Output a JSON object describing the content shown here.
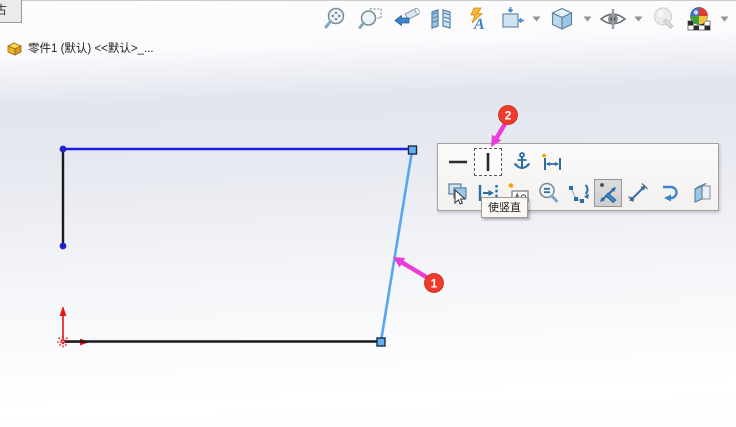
{
  "tabs": {
    "partial_tab_text": "古"
  },
  "feature_tree": {
    "part_label": "零件1 (默认) <<默认>_..."
  },
  "headsup_toolbar": {
    "items": [
      "zoom-to-fit",
      "zoom-to-area",
      "previous-view",
      "section-view",
      "dynamic-annotation-views",
      "view-orientation",
      "display-style",
      "hide-show-items",
      "edit-appearance",
      "apply-scene"
    ]
  },
  "context_toolbar": {
    "row1": [
      "make-horizontal",
      "make-vertical",
      "fix",
      "smart-dimension"
    ],
    "row2": [
      "select-other",
      "auto-insert-dimension",
      "fully-define-sketch",
      "zoom-to-selection",
      "display-delete-relations",
      "smart-dimension-pressed",
      "dimension-tool",
      "undo",
      "view-cube"
    ],
    "tooltip_text": "使竖直"
  },
  "annotations": {
    "balloon_1": "1",
    "balloon_2": "2"
  },
  "colors": {
    "line_black": "#1b1b1b",
    "line_selected_blue": "#1c1ce0",
    "line_highlight_blue": "#55a7f2",
    "endpoint_fill": "#63aef2",
    "endpoint_stroke": "#1c2b45",
    "vertex_dot": "#2121cf",
    "origin_red": "#e81414",
    "balloon_red": "#ee3b2b",
    "arrow_magenta": "#e93cda",
    "icon_blue": "#2e6da4",
    "icon_steel": "#5b7f99",
    "sparkle_orange": "#f0a500"
  }
}
